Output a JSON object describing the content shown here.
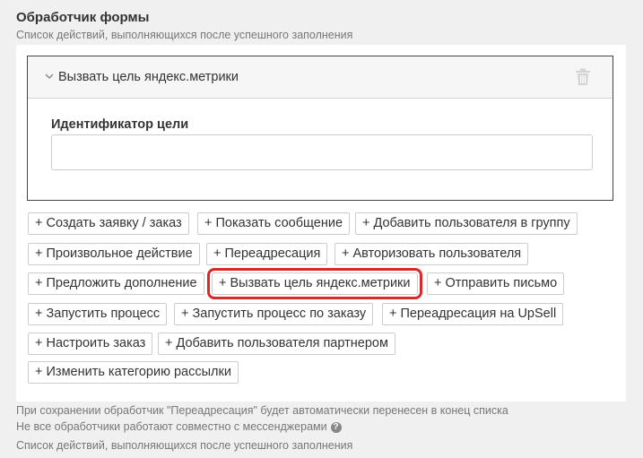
{
  "header": {
    "title": "Обработчик формы",
    "subtitle": "Список действий, выполняющихся после успешного заполнения"
  },
  "action": {
    "title": "Вызвать цель яндекс.метрики",
    "field_label": "Идентификатор цели",
    "field_value": "",
    "icons": {
      "collapse": "chevron-down-icon",
      "delete": "trash-icon"
    }
  },
  "buttons": [
    {
      "label": "+ Создать заявку / заказ"
    },
    {
      "label": "+ Показать сообщение"
    },
    {
      "label": "+ Добавить пользователя в группу"
    },
    {
      "label": "+ Произвольное действие"
    },
    {
      "label": "+ Переадресация"
    },
    {
      "label": "+ Авторизовать пользователя"
    },
    {
      "label": "+ Предложить дополнение"
    },
    {
      "label": "+ Вызвать цель яндекс.метрики",
      "highlighted": true
    },
    {
      "label": "+ Отправить письмо"
    },
    {
      "label": "+ Запустить процесс"
    },
    {
      "label": "+ Запустить процесс по заказу"
    },
    {
      "label": "+ Переадресация на UpSell"
    },
    {
      "label": "+ Настроить заказ"
    },
    {
      "label": "+ Добавить пользователя партнером"
    },
    {
      "label": "+ Изменить категорию рассылки"
    }
  ],
  "notes": {
    "line1": "При сохранении обработчик \"Переадресация\" будет автоматически перенесен в конец списка",
    "line2": "Не все обработчики работают совместно с мессенджерами",
    "line3": "Список действий, выполняющихся после успешного заполнения"
  },
  "colors": {
    "highlight": "#d82a2a",
    "background": "#f0f0f0"
  }
}
